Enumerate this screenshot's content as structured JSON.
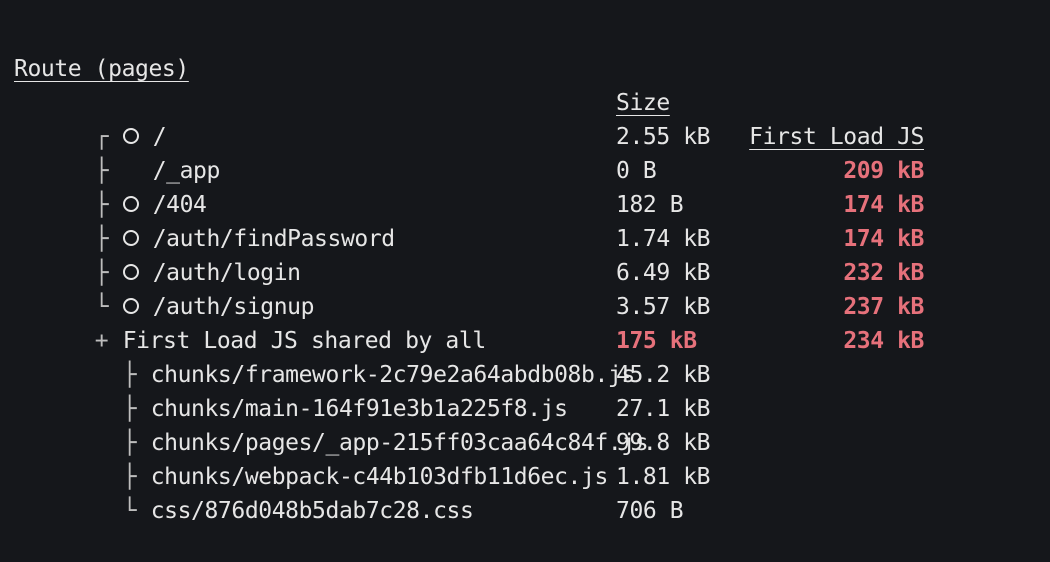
{
  "header": {
    "route": "Route (pages)",
    "size": "Size",
    "first_load": "First Load JS"
  },
  "routes": [
    {
      "tree": "┌",
      "icon": "static-circle",
      "path": "/",
      "size": "2.55 kB",
      "first_load": "209 kB"
    },
    {
      "tree": "├",
      "icon": "none",
      "path": "/_app",
      "size": "0 B",
      "first_load": "174 kB"
    },
    {
      "tree": "├",
      "icon": "static-circle",
      "path": "/404",
      "size": "182 B",
      "first_load": "174 kB"
    },
    {
      "tree": "├",
      "icon": "static-circle",
      "path": "/auth/findPassword",
      "size": "1.74 kB",
      "first_load": "232 kB"
    },
    {
      "tree": "├",
      "icon": "static-circle",
      "path": "/auth/login",
      "size": "6.49 kB",
      "first_load": "237 kB"
    },
    {
      "tree": "└",
      "icon": "static-circle",
      "path": "/auth/signup",
      "size": "3.57 kB",
      "first_load": "234 kB"
    }
  ],
  "shared": {
    "prefix": "+",
    "label": "First Load JS shared by all",
    "size": "175 kB"
  },
  "chunks": [
    {
      "tree": "├",
      "name": "chunks/framework-2c79e2a64abdb08b.js",
      "size": "45.2 kB"
    },
    {
      "tree": "├",
      "name": "chunks/main-164f91e3b1a225f8.js",
      "size": "27.1 kB"
    },
    {
      "tree": "├",
      "name": "chunks/pages/_app-215ff03caa64c84f.js",
      "size": "99.8 kB"
    },
    {
      "tree": "├",
      "name": "chunks/webpack-c44b103dfb11d6ec.js",
      "size": "1.81 kB"
    },
    {
      "tree": "└",
      "name": "css/876d048b5dab7c28.css",
      "size": "706 B"
    }
  ],
  "colors": {
    "background": "#15171b",
    "text": "#e6e6e6",
    "highlight": "#e6717b"
  }
}
